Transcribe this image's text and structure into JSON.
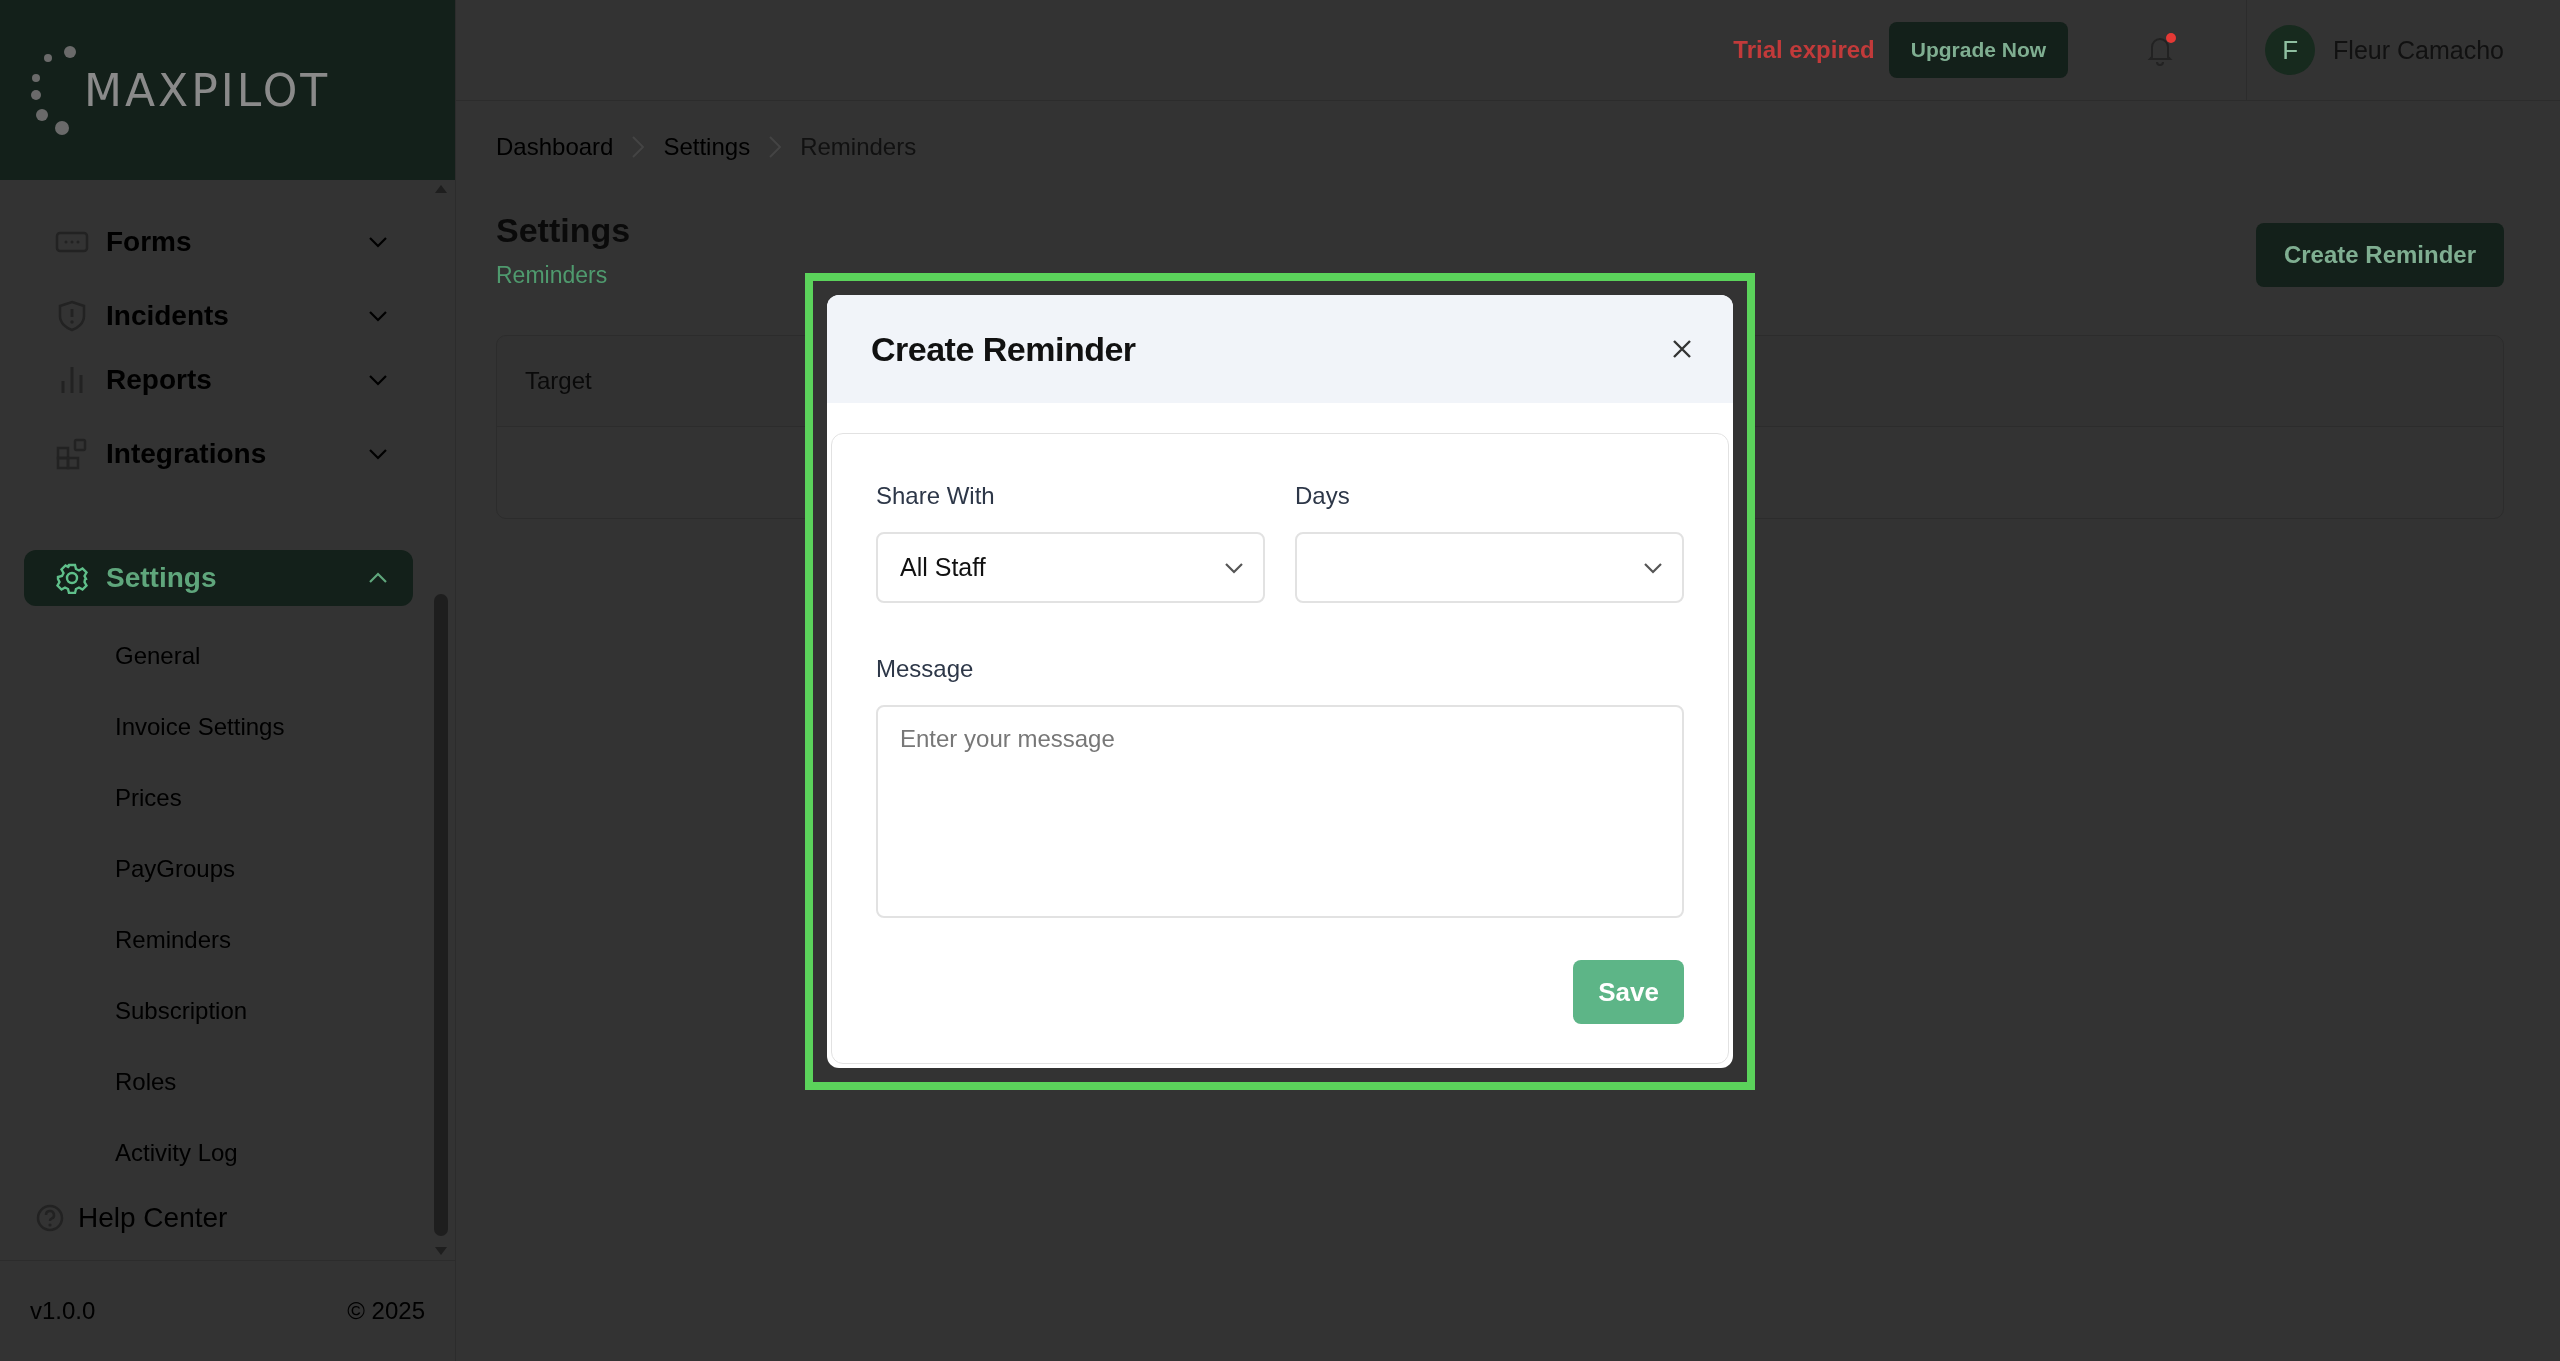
{
  "sidebar": {
    "logo": "MAXPILOT",
    "nav": [
      {
        "label": "Forms",
        "expanded": false,
        "selected": false
      },
      {
        "label": "Incidents",
        "expanded": false,
        "selected": false
      },
      {
        "label": "Reports",
        "expanded": false,
        "selected": false
      },
      {
        "label": "Integrations",
        "expanded": false,
        "selected": false
      },
      {
        "label": "Settings",
        "expanded": true,
        "selected": true,
        "children": [
          "General",
          "Invoice Settings",
          "Prices",
          "PayGroups",
          "Reminders",
          "Subscription",
          "Roles",
          "Activity Log"
        ]
      }
    ],
    "help": "Help Center",
    "version": "v1.0.0",
    "copyright": "© 2025"
  },
  "header": {
    "trial_status": "Trial expired",
    "upgrade_button": "Upgrade Now",
    "notifications": {
      "unread": true
    },
    "user": {
      "initial": "F",
      "name": "Fleur Camacho"
    }
  },
  "main": {
    "breadcrumb": [
      "Dashboard",
      "Settings",
      "Reminders"
    ],
    "title": "Settings",
    "subtitle": "Reminders",
    "create_button": "Create Reminder",
    "table": {
      "columns": [
        "Target"
      ]
    }
  },
  "modal": {
    "title": "Create Reminder",
    "highlighted": true,
    "selects": [
      {
        "label": "Share With",
        "value": "All Staff"
      },
      {
        "label": "Days"
      }
    ],
    "message": {
      "label": "Message",
      "placeholder": "Enter your message"
    },
    "save_button": "Save"
  }
}
